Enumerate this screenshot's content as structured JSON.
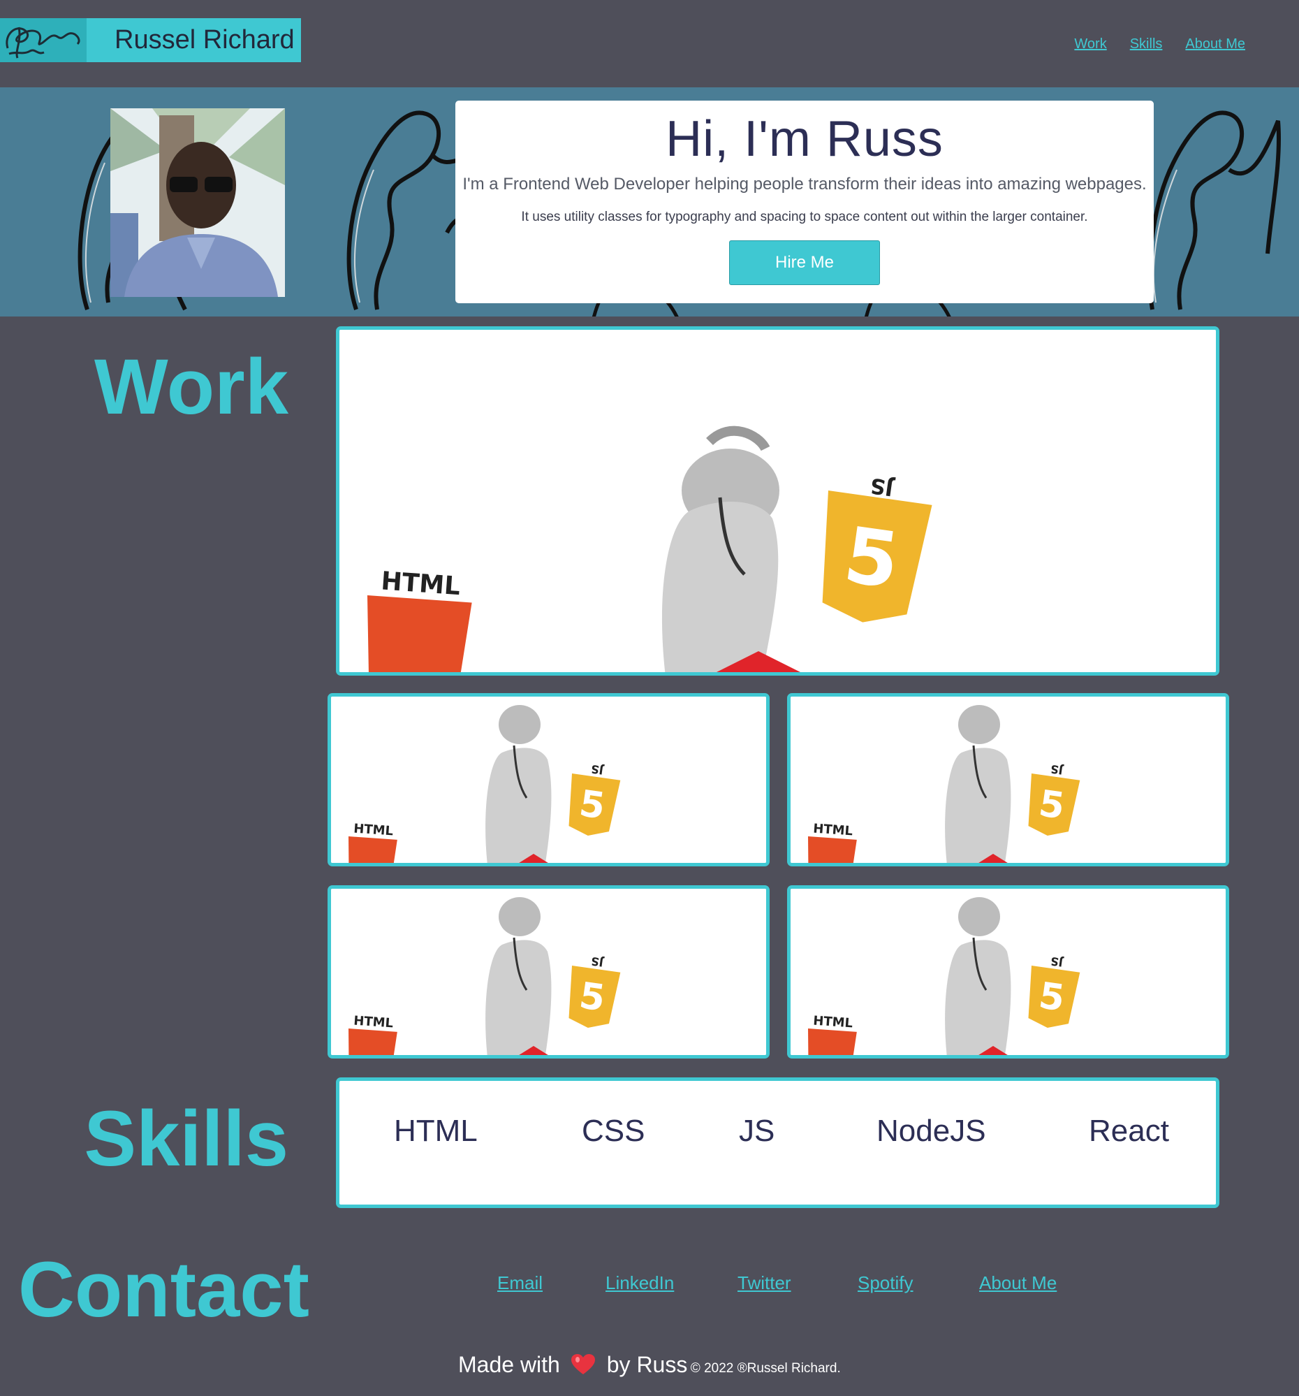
{
  "header": {
    "brand_name": "Russel Richard",
    "nav": [
      {
        "label": "Work"
      },
      {
        "label": "Skills"
      },
      {
        "label": "About Me"
      }
    ]
  },
  "hero": {
    "title": "Hi, I'm Russ",
    "lead": "I'm a Frontend Web Developer helping people transform their ideas into amazing webpages.",
    "sub": "It uses utility classes for typography and spacing to space content out within the larger container.",
    "button_label": "Hire Me"
  },
  "work": {
    "title": "Work",
    "card_text": {
      "html": "HTML",
      "js": "JS"
    }
  },
  "skills": {
    "title": "Skills",
    "items": [
      "HTML",
      "CSS",
      "JS",
      "NodeJS",
      "React"
    ]
  },
  "contact": {
    "title": "Contact",
    "links": [
      "Email",
      "LinkedIn",
      "Twitter",
      "Spotify",
      "About Me"
    ]
  },
  "footer": {
    "made_with": "Made with",
    "by": "by Russ",
    "copyright": "© 2022 ®Russel Richard."
  },
  "colors": {
    "background": "#4f4f5a",
    "accent": "#3fc8d2",
    "hero_band": "#4a7d95",
    "text_dark": "#2c2e55"
  }
}
